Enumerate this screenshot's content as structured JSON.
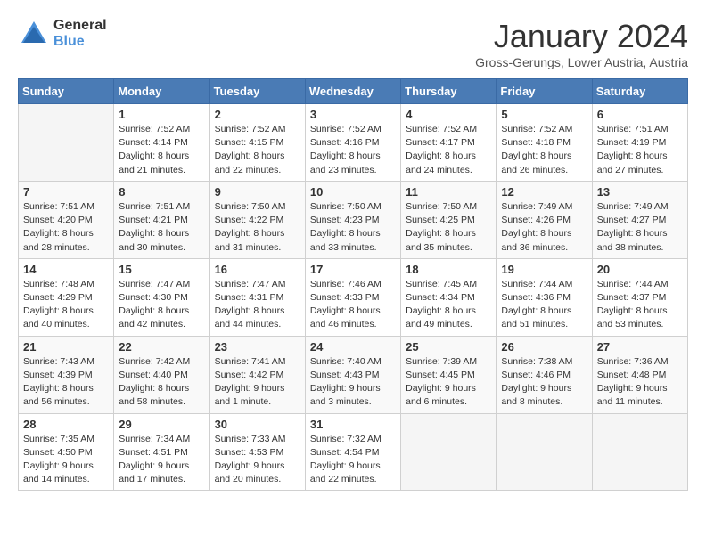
{
  "logo": {
    "general": "General",
    "blue": "Blue"
  },
  "header": {
    "title": "January 2024",
    "subtitle": "Gross-Gerungs, Lower Austria, Austria"
  },
  "days_of_week": [
    "Sunday",
    "Monday",
    "Tuesday",
    "Wednesday",
    "Thursday",
    "Friday",
    "Saturday"
  ],
  "weeks": [
    [
      {
        "day": "",
        "info": ""
      },
      {
        "day": "1",
        "info": "Sunrise: 7:52 AM\nSunset: 4:14 PM\nDaylight: 8 hours\nand 21 minutes."
      },
      {
        "day": "2",
        "info": "Sunrise: 7:52 AM\nSunset: 4:15 PM\nDaylight: 8 hours\nand 22 minutes."
      },
      {
        "day": "3",
        "info": "Sunrise: 7:52 AM\nSunset: 4:16 PM\nDaylight: 8 hours\nand 23 minutes."
      },
      {
        "day": "4",
        "info": "Sunrise: 7:52 AM\nSunset: 4:17 PM\nDaylight: 8 hours\nand 24 minutes."
      },
      {
        "day": "5",
        "info": "Sunrise: 7:52 AM\nSunset: 4:18 PM\nDaylight: 8 hours\nand 26 minutes."
      },
      {
        "day": "6",
        "info": "Sunrise: 7:51 AM\nSunset: 4:19 PM\nDaylight: 8 hours\nand 27 minutes."
      }
    ],
    [
      {
        "day": "7",
        "info": "Sunrise: 7:51 AM\nSunset: 4:20 PM\nDaylight: 8 hours\nand 28 minutes."
      },
      {
        "day": "8",
        "info": "Sunrise: 7:51 AM\nSunset: 4:21 PM\nDaylight: 8 hours\nand 30 minutes."
      },
      {
        "day": "9",
        "info": "Sunrise: 7:50 AM\nSunset: 4:22 PM\nDaylight: 8 hours\nand 31 minutes."
      },
      {
        "day": "10",
        "info": "Sunrise: 7:50 AM\nSunset: 4:23 PM\nDaylight: 8 hours\nand 33 minutes."
      },
      {
        "day": "11",
        "info": "Sunrise: 7:50 AM\nSunset: 4:25 PM\nDaylight: 8 hours\nand 35 minutes."
      },
      {
        "day": "12",
        "info": "Sunrise: 7:49 AM\nSunset: 4:26 PM\nDaylight: 8 hours\nand 36 minutes."
      },
      {
        "day": "13",
        "info": "Sunrise: 7:49 AM\nSunset: 4:27 PM\nDaylight: 8 hours\nand 38 minutes."
      }
    ],
    [
      {
        "day": "14",
        "info": "Sunrise: 7:48 AM\nSunset: 4:29 PM\nDaylight: 8 hours\nand 40 minutes."
      },
      {
        "day": "15",
        "info": "Sunrise: 7:47 AM\nSunset: 4:30 PM\nDaylight: 8 hours\nand 42 minutes."
      },
      {
        "day": "16",
        "info": "Sunrise: 7:47 AM\nSunset: 4:31 PM\nDaylight: 8 hours\nand 44 minutes."
      },
      {
        "day": "17",
        "info": "Sunrise: 7:46 AM\nSunset: 4:33 PM\nDaylight: 8 hours\nand 46 minutes."
      },
      {
        "day": "18",
        "info": "Sunrise: 7:45 AM\nSunset: 4:34 PM\nDaylight: 8 hours\nand 49 minutes."
      },
      {
        "day": "19",
        "info": "Sunrise: 7:44 AM\nSunset: 4:36 PM\nDaylight: 8 hours\nand 51 minutes."
      },
      {
        "day": "20",
        "info": "Sunrise: 7:44 AM\nSunset: 4:37 PM\nDaylight: 8 hours\nand 53 minutes."
      }
    ],
    [
      {
        "day": "21",
        "info": "Sunrise: 7:43 AM\nSunset: 4:39 PM\nDaylight: 8 hours\nand 56 minutes."
      },
      {
        "day": "22",
        "info": "Sunrise: 7:42 AM\nSunset: 4:40 PM\nDaylight: 8 hours\nand 58 minutes."
      },
      {
        "day": "23",
        "info": "Sunrise: 7:41 AM\nSunset: 4:42 PM\nDaylight: 9 hours\nand 1 minute."
      },
      {
        "day": "24",
        "info": "Sunrise: 7:40 AM\nSunset: 4:43 PM\nDaylight: 9 hours\nand 3 minutes."
      },
      {
        "day": "25",
        "info": "Sunrise: 7:39 AM\nSunset: 4:45 PM\nDaylight: 9 hours\nand 6 minutes."
      },
      {
        "day": "26",
        "info": "Sunrise: 7:38 AM\nSunset: 4:46 PM\nDaylight: 9 hours\nand 8 minutes."
      },
      {
        "day": "27",
        "info": "Sunrise: 7:36 AM\nSunset: 4:48 PM\nDaylight: 9 hours\nand 11 minutes."
      }
    ],
    [
      {
        "day": "28",
        "info": "Sunrise: 7:35 AM\nSunset: 4:50 PM\nDaylight: 9 hours\nand 14 minutes."
      },
      {
        "day": "29",
        "info": "Sunrise: 7:34 AM\nSunset: 4:51 PM\nDaylight: 9 hours\nand 17 minutes."
      },
      {
        "day": "30",
        "info": "Sunrise: 7:33 AM\nSunset: 4:53 PM\nDaylight: 9 hours\nand 20 minutes."
      },
      {
        "day": "31",
        "info": "Sunrise: 7:32 AM\nSunset: 4:54 PM\nDaylight: 9 hours\nand 22 minutes."
      },
      {
        "day": "",
        "info": ""
      },
      {
        "day": "",
        "info": ""
      },
      {
        "day": "",
        "info": ""
      }
    ]
  ]
}
